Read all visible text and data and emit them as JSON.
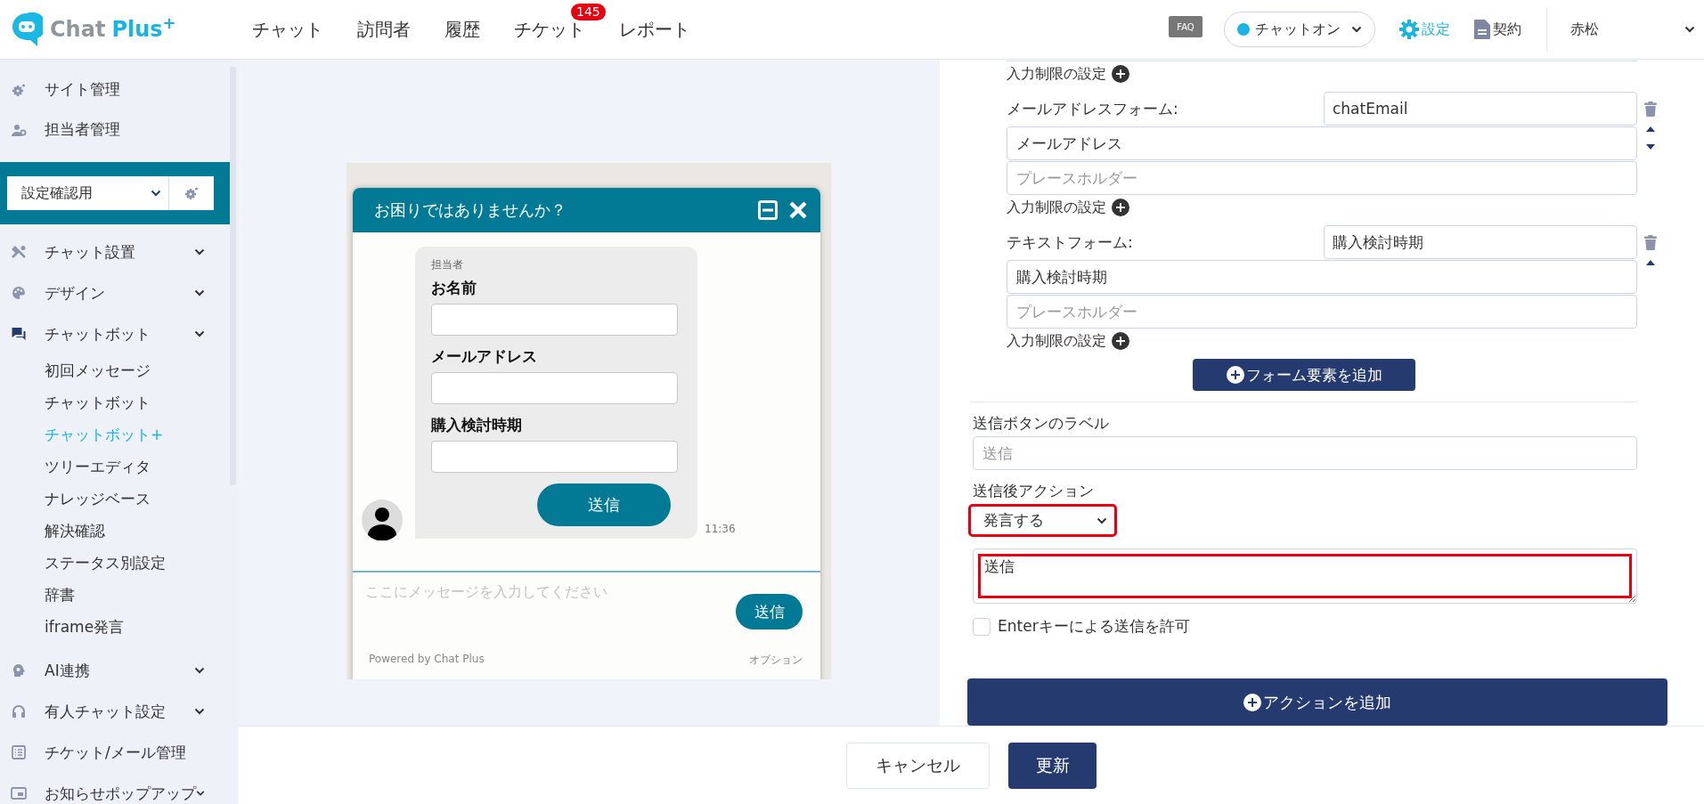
{
  "header": {
    "logo": {
      "word_1": "Chat",
      "word_2": "Plus",
      "mark": "+"
    },
    "nav": [
      {
        "label": "チャット"
      },
      {
        "label": "訪問者"
      },
      {
        "label": "履歴"
      },
      {
        "label": "チケット",
        "badge": "145"
      },
      {
        "label": "レポート"
      }
    ],
    "faq": "FAQ",
    "status": {
      "label": "チャットオン",
      "online": true
    },
    "links": [
      {
        "label": "設定",
        "selected": true
      },
      {
        "label": "契約",
        "selected": false
      }
    ],
    "user": "赤松"
  },
  "sidebar": {
    "top_items": [
      {
        "label": "サイト管理"
      },
      {
        "label": "担当者管理"
      }
    ],
    "site_select": {
      "value": "設定確認用"
    },
    "items": [
      {
        "label": "チャット設置",
        "kind": "group"
      },
      {
        "label": "デザイン",
        "kind": "group"
      },
      {
        "label": "チャットボット",
        "kind": "group",
        "children": [
          {
            "label": "初回メッセージ",
            "selected": false
          },
          {
            "label": "チャットボット",
            "selected": false
          },
          {
            "label": "チャットボット+",
            "selected": true
          },
          {
            "label": "ツリーエディタ",
            "selected": false
          },
          {
            "label": "ナレッジベース",
            "selected": false
          },
          {
            "label": "解決確認",
            "selected": false
          },
          {
            "label": "ステータス別設定",
            "selected": false
          },
          {
            "label": "辞書",
            "selected": false
          },
          {
            "label": "iframe発言",
            "selected": false
          }
        ]
      },
      {
        "label": "AI連携",
        "kind": "group"
      },
      {
        "label": "有人チャット設定",
        "kind": "group"
      },
      {
        "label": "チケット/メール管理",
        "kind": "link"
      },
      {
        "label": "お知らせポップアップ",
        "kind": "group"
      }
    ]
  },
  "preview": {
    "title": "お困りではありませんか？",
    "message": {
      "sender": "担当者",
      "fields": [
        "お名前",
        "メールアドレス",
        "購入検討時期"
      ],
      "submit": "送信",
      "time": "11:36"
    },
    "composer": {
      "placeholder": "ここにメッセージを入力してください",
      "send": "送信"
    },
    "footer": {
      "powered_by": "Powered by Chat Plus",
      "options": "オプション"
    }
  },
  "editor": {
    "form_elements": [
      {
        "kind": "partial",
        "limit": "入力制限の設定"
      },
      {
        "kind": "full",
        "type_label": "メールアドレスフォーム:",
        "key": "chatEmail",
        "label": "メールアドレス",
        "placeholder": "プレースホルダー",
        "limit": "入力制限の設定",
        "move_up": true,
        "move_down": true
      },
      {
        "kind": "full",
        "type_label": "テキストフォーム:",
        "key": "購入検討時期",
        "label": "購入検討時期",
        "placeholder": "プレースホルダー",
        "limit": "入力制限の設定",
        "move_up": true,
        "move_down": false
      }
    ],
    "add_element": "フォーム要素を追加",
    "button_label": {
      "label": "送信ボタンのラベル",
      "placeholder": "送信"
    },
    "after_action": {
      "label": "送信後アクション",
      "value": "発言する",
      "highlighted": true
    },
    "message": {
      "value": "送信",
      "highlighted": true
    },
    "enter_key": {
      "label": "Enterキーによる送信を許可",
      "checked": false
    },
    "add_action": "アクションを追加"
  },
  "footer": {
    "buttons": [
      {
        "label": "キャンセル",
        "kind": "secondary"
      },
      {
        "label": "更新",
        "kind": "primary"
      }
    ]
  }
}
